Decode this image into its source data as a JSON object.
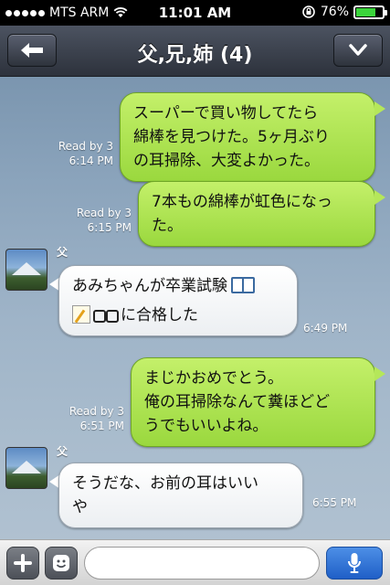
{
  "status_bar": {
    "carrier": "MTS ARM",
    "time": "11:01 AM",
    "battery": "76%",
    "battery_level": 0.76,
    "icons": [
      "signal-dots-icon",
      "wifi-icon",
      "rotation-lock-icon",
      "battery-icon"
    ]
  },
  "header": {
    "title": "父,兄,姉 (4)",
    "back_icon": "arrow-left-icon",
    "menu_icon": "chevron-down-icon"
  },
  "messages": [
    {
      "direction": "out",
      "lines": [
        "スーパーで買い物してたら",
        "綿棒を見つけた。5ヶ月ぶり",
        "の耳掃除、大変よかった。"
      ],
      "read": "Read by 3",
      "time": "6:14 PM"
    },
    {
      "direction": "out",
      "lines": [
        "7本もの綿棒が虹色になっ",
        "た。"
      ],
      "read": "Read by 3",
      "time": "6:15 PM"
    },
    {
      "direction": "in",
      "sender": "父",
      "lines": [
        "あみちゃんが卒業試験",
        "に合格した"
      ],
      "emoji": [
        "book-icon",
        "memo-icon",
        "glasses-icon"
      ],
      "time": "6:49 PM"
    },
    {
      "direction": "out",
      "lines": [
        "まじかおめでとう。",
        "俺の耳掃除なんて糞ほどど",
        "うでもいいよね。"
      ],
      "read": "Read by 3",
      "time": "6:51 PM"
    },
    {
      "direction": "in",
      "sender": "父",
      "lines": [
        "そうだな、お前の耳はいい",
        "や"
      ],
      "time": "6:55 PM"
    }
  ],
  "input_bar": {
    "plus_icon": "plus-icon",
    "sticker_icon": "smiley-icon",
    "placeholder": "",
    "mic_icon": "microphone-icon"
  }
}
